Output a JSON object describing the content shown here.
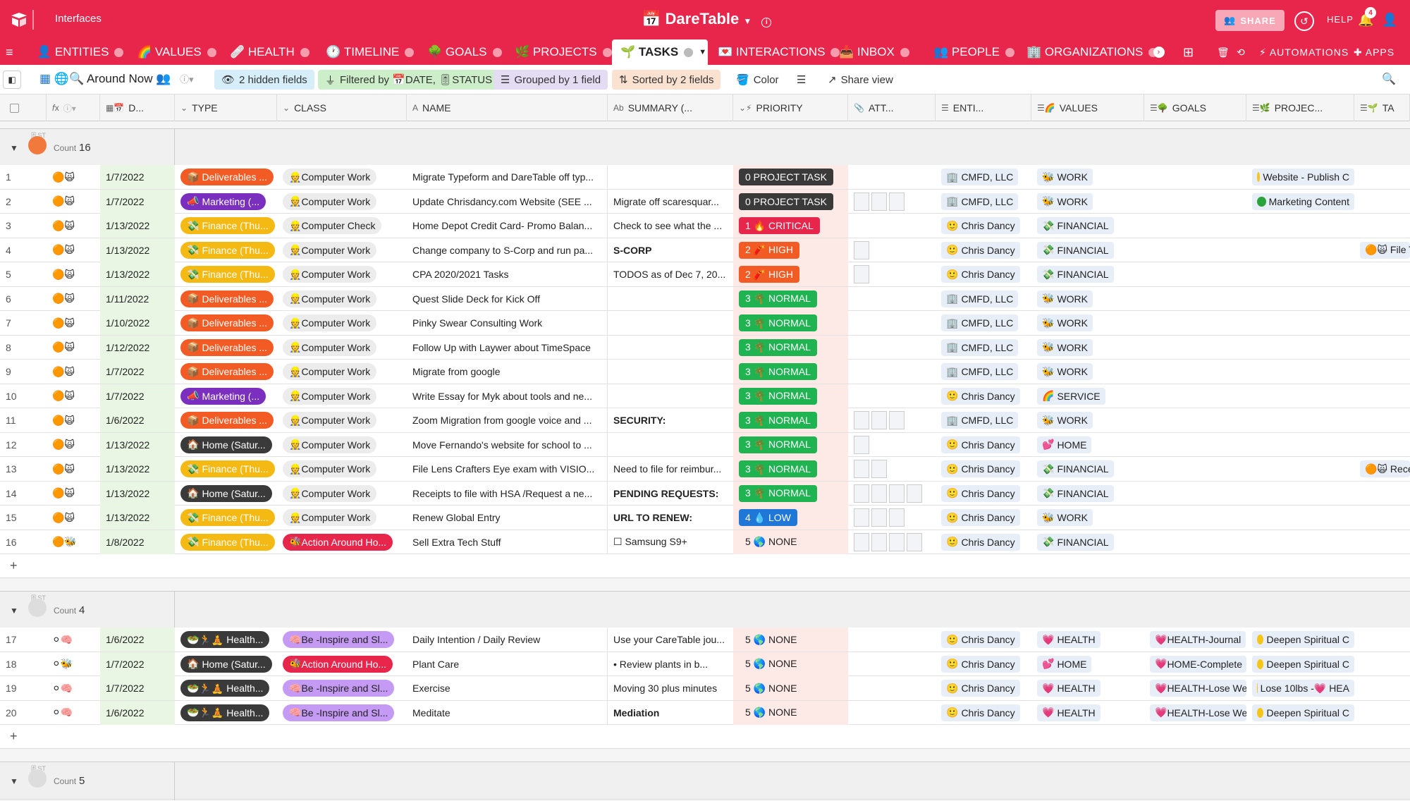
{
  "app": {
    "workspace_label": "Interfaces",
    "base_title": "DareTable",
    "share_label": "SHARE",
    "help_label": "HELP",
    "notification_count": "4"
  },
  "tabs": [
    {
      "label": "ENTITIES",
      "emoji": "👤"
    },
    {
      "label": "VALUES",
      "emoji": "🌈"
    },
    {
      "label": "HEALTH",
      "emoji": "🩹"
    },
    {
      "label": "TIMELINE",
      "emoji": "🕐"
    },
    {
      "label": "GOALS",
      "emoji": "🌳"
    },
    {
      "label": "PROJECTS",
      "emoji": "🌿"
    },
    {
      "label": "TASKS",
      "emoji": "🌱"
    },
    {
      "label": "INTERACTIONS",
      "emoji": "💌"
    },
    {
      "label": "INBOX",
      "emoji": "📥"
    },
    {
      "label": "PEOPLE",
      "emoji": "👥"
    },
    {
      "label": "ORGANIZATIONS",
      "emoji": "🏢"
    }
  ],
  "tab_actions": {
    "automations": "AUTOMATIONS",
    "apps": "APPS"
  },
  "view": {
    "name": "Around Now",
    "hidden_fields": "2 hidden fields",
    "filter_prefix": "Filtered by",
    "filter_date": "DATE,",
    "filter_status": "STATUS",
    "grouped": "Grouped by 1 field",
    "sorted": "Sorted by 2 fields",
    "color": "Color",
    "share_view": "Share view"
  },
  "columns": {
    "date": "D...",
    "type": "TYPE",
    "class": "CLASS",
    "name": "NAME",
    "summary": "SUMMARY (...",
    "priority": "PRIORITY",
    "attachments": "ATT...",
    "entities": "ENTI...",
    "values": "VALUES",
    "goals": "GOALS",
    "projects": "PROJEC...",
    "last": "TA"
  },
  "groups": [
    {
      "count_label": "Count",
      "count": "16",
      "icon_color": "#f2793c",
      "rows": [
        {
          "n": "1",
          "status": "🟠🙀",
          "date": "1/7/2022",
          "type": "Deliverables ...",
          "type_bg": "#f25c24",
          "type_emoji": "📦",
          "class": "Computer Work",
          "class_kind": "grey",
          "name": "Migrate Typeform and DareTable off typ...",
          "summary": "",
          "summary_bold": false,
          "priority": "0 PROJECT TASK",
          "prio_bg": "#3a3a3a",
          "att": 0,
          "entity": "CMFD, LLC",
          "entity_emoji": "🏢",
          "value": "WORK",
          "value_emoji": "🐝",
          "goal": "",
          "project": "Website - Publish C",
          "project_dot": "#f5c518",
          "last": ""
        },
        {
          "n": "2",
          "status": "🟠🙀",
          "date": "1/7/2022",
          "type": "Marketing (...",
          "type_bg": "#7b2fbf",
          "type_emoji": "📣",
          "class": "Computer Work",
          "class_kind": "grey",
          "name": "Update Chrisdancy.com Website (SEE ...",
          "summary": "Migrate off scaresquar...",
          "summary_bold": false,
          "priority": "0 PROJECT TASK",
          "prio_bg": "#3a3a3a",
          "att": 3,
          "entity": "CMFD, LLC",
          "entity_emoji": "🏢",
          "value": "WORK",
          "value_emoji": "🐝",
          "goal": "",
          "project": "Marketing Content",
          "project_dot": "#2aa43a",
          "last": ""
        },
        {
          "n": "3",
          "status": "🟠🙀",
          "date": "1/13/2022",
          "type": "Finance (Thu...",
          "type_bg": "#f5b914",
          "type_emoji": "💸",
          "class": "Computer Check",
          "class_kind": "grey",
          "name": "Home Depot Credit Card- Promo Balan...",
          "summary": "Check to see what the ...",
          "summary_bold": false,
          "priority": "1 🔥 CRITICAL",
          "prio_bg": "#e8254a",
          "att": 0,
          "entity": "Chris Dancy",
          "entity_emoji": "🙂",
          "value": "FINANCIAL",
          "value_emoji": "💸",
          "goal": "",
          "project": "",
          "project_dot": "",
          "last": ""
        },
        {
          "n": "4",
          "status": "🟠🙀",
          "date": "1/13/2022",
          "type": "Finance (Thu...",
          "type_bg": "#f5b914",
          "type_emoji": "💸",
          "class": "Computer Work",
          "class_kind": "grey",
          "name": "Change company to S-Corp and run pa...",
          "summary": "S-CORP",
          "summary_bold": true,
          "priority": "2 🧨 HIGH",
          "prio_bg": "#f25c24",
          "att": 1,
          "entity": "Chris Dancy",
          "entity_emoji": "🙂",
          "value": "FINANCIAL",
          "value_emoji": "💸",
          "goal": "",
          "project": "",
          "project_dot": "",
          "last": "🟠🙀 File T"
        },
        {
          "n": "5",
          "status": "🟠🙀",
          "date": "1/13/2022",
          "type": "Finance (Thu...",
          "type_bg": "#f5b914",
          "type_emoji": "💸",
          "class": "Computer Work",
          "class_kind": "grey",
          "name": "CPA 2020/2021 Tasks",
          "summary": "TODOS as of Dec 7, 20...",
          "summary_bold": false,
          "priority": "2 🧨 HIGH",
          "prio_bg": "#f25c24",
          "att": 1,
          "entity": "Chris Dancy",
          "entity_emoji": "🙂",
          "value": "FINANCIAL",
          "value_emoji": "💸",
          "goal": "",
          "project": "",
          "project_dot": "",
          "last": ""
        },
        {
          "n": "6",
          "status": "🟠🙀",
          "date": "1/11/2022",
          "type": "Deliverables ...",
          "type_bg": "#f25c24",
          "type_emoji": "📦",
          "class": "Computer Work",
          "class_kind": "grey",
          "name": "Quest Slide Deck for Kick Off",
          "summary": "",
          "summary_bold": false,
          "priority": "3 🌴 NORMAL",
          "prio_bg": "#20b352",
          "att": 0,
          "entity": "CMFD, LLC",
          "entity_emoji": "🏢",
          "value": "WORK",
          "value_emoji": "🐝",
          "goal": "",
          "project": "",
          "project_dot": "",
          "last": ""
        },
        {
          "n": "7",
          "status": "🟠🙀",
          "date": "1/10/2022",
          "type": "Deliverables ...",
          "type_bg": "#f25c24",
          "type_emoji": "📦",
          "class": "Computer Work",
          "class_kind": "grey",
          "name": "Pinky Swear Consulting Work",
          "summary": "",
          "summary_bold": false,
          "priority": "3 🌴 NORMAL",
          "prio_bg": "#20b352",
          "att": 0,
          "entity": "CMFD, LLC",
          "entity_emoji": "🏢",
          "value": "WORK",
          "value_emoji": "🐝",
          "goal": "",
          "project": "",
          "project_dot": "",
          "last": ""
        },
        {
          "n": "8",
          "status": "🟠🙀",
          "date": "1/12/2022",
          "type": "Deliverables ...",
          "type_bg": "#f25c24",
          "type_emoji": "📦",
          "class": "Computer Work",
          "class_kind": "grey",
          "name": "Follow Up with Laywer about TimeSpace",
          "summary": "",
          "summary_bold": false,
          "priority": "3 🌴 NORMAL",
          "prio_bg": "#20b352",
          "att": 0,
          "entity": "CMFD, LLC",
          "entity_emoji": "🏢",
          "value": "WORK",
          "value_emoji": "🐝",
          "goal": "",
          "project": "",
          "project_dot": "",
          "last": ""
        },
        {
          "n": "9",
          "status": "🟠🙀",
          "date": "1/7/2022",
          "type": "Deliverables ...",
          "type_bg": "#f25c24",
          "type_emoji": "📦",
          "class": "Computer Work",
          "class_kind": "grey",
          "name": "Migrate from google",
          "summary": "",
          "summary_bold": false,
          "priority": "3 🌴 NORMAL",
          "prio_bg": "#20b352",
          "att": 0,
          "entity": "CMFD, LLC",
          "entity_emoji": "🏢",
          "value": "WORK",
          "value_emoji": "🐝",
          "goal": "",
          "project": "",
          "project_dot": "",
          "last": ""
        },
        {
          "n": "10",
          "status": "🟠🙀",
          "date": "1/7/2022",
          "type": "Marketing (...",
          "type_bg": "#7b2fbf",
          "type_emoji": "📣",
          "class": "Computer Work",
          "class_kind": "grey",
          "name": "Write Essay for Myk about tools and ne...",
          "summary": "",
          "summary_bold": false,
          "priority": "3 🌴 NORMAL",
          "prio_bg": "#20b352",
          "att": 0,
          "entity": "Chris Dancy",
          "entity_emoji": "🙂",
          "value": "SERVICE",
          "value_emoji": "🌈",
          "goal": "",
          "project": "",
          "project_dot": "",
          "last": ""
        },
        {
          "n": "11",
          "status": "🟠🙀",
          "date": "1/6/2022",
          "type": "Deliverables ...",
          "type_bg": "#f25c24",
          "type_emoji": "📦",
          "class": "Computer Work",
          "class_kind": "grey",
          "name": "Zoom Migration from google voice and ...",
          "summary": "SECURITY:",
          "summary_bold": true,
          "priority": "3 🌴 NORMAL",
          "prio_bg": "#20b352",
          "att": 3,
          "entity": "CMFD, LLC",
          "entity_emoji": "🏢",
          "value": "WORK",
          "value_emoji": "🐝",
          "goal": "",
          "project": "",
          "project_dot": "",
          "last": ""
        },
        {
          "n": "12",
          "status": "🟠🙀",
          "date": "1/13/2022",
          "type": "Home (Satur...",
          "type_bg": "#3a3a3a",
          "type_emoji": "🏠",
          "class": "Computer Work",
          "class_kind": "grey",
          "name": "Move Fernando's website for school to ...",
          "summary": "",
          "summary_bold": false,
          "priority": "3 🌴 NORMAL",
          "prio_bg": "#20b352",
          "att": 1,
          "entity": "Chris Dancy",
          "entity_emoji": "🙂",
          "value": "HOME",
          "value_emoji": "💕",
          "goal": "",
          "project": "",
          "project_dot": "",
          "last": ""
        },
        {
          "n": "13",
          "status": "🟠🙀",
          "date": "1/13/2022",
          "type": "Finance (Thu...",
          "type_bg": "#f5b914",
          "type_emoji": "💸",
          "class": "Computer Work",
          "class_kind": "grey",
          "name": "File Lens Crafters Eye exam with VISIO...",
          "summary": "Need to file for reimbur...",
          "summary_bold": false,
          "priority": "3 🌴 NORMAL",
          "prio_bg": "#20b352",
          "att": 2,
          "entity": "Chris Dancy",
          "entity_emoji": "🙂",
          "value": "FINANCIAL",
          "value_emoji": "💸",
          "goal": "",
          "project": "",
          "project_dot": "",
          "last": "🟠🙀 Rece"
        },
        {
          "n": "14",
          "status": "🟠🙀",
          "date": "1/13/2022",
          "type": "Home (Satur...",
          "type_bg": "#3a3a3a",
          "type_emoji": "🏠",
          "class": "Computer Work",
          "class_kind": "grey",
          "name": "Receipts to file with HSA /Request a ne...",
          "summary": "PENDING REQUESTS:",
          "summary_bold": true,
          "priority": "3 🌴 NORMAL",
          "prio_bg": "#20b352",
          "att": 4,
          "entity": "Chris Dancy",
          "entity_emoji": "🙂",
          "value": "FINANCIAL",
          "value_emoji": "💸",
          "goal": "",
          "project": "",
          "project_dot": "",
          "last": ""
        },
        {
          "n": "15",
          "status": "🟠🙀",
          "date": "1/13/2022",
          "type": "Finance (Thu...",
          "type_bg": "#f5b914",
          "type_emoji": "💸",
          "class": "Computer Work",
          "class_kind": "grey",
          "name": "Renew Global Entry",
          "summary": "URL TO RENEW:",
          "summary_bold": true,
          "priority": "4 💧 LOW",
          "prio_bg": "#1f78d8",
          "att": 3,
          "entity": "Chris Dancy",
          "entity_emoji": "🙂",
          "value": "WORK",
          "value_emoji": "🐝",
          "goal": "",
          "project": "",
          "project_dot": "",
          "last": ""
        },
        {
          "n": "16",
          "status": "🟠🐝",
          "date": "1/8/2022",
          "type": "Finance (Thu...",
          "type_bg": "#f5b914",
          "type_emoji": "💸",
          "class": "Action Around Ho...",
          "class_kind": "red",
          "name": "Sell Extra Tech Stuff",
          "summary": "☐ Samsung S9+",
          "summary_bold": false,
          "priority": "5 🌎 NONE",
          "prio_bg": "",
          "att": 4,
          "entity": "Chris Dancy",
          "entity_emoji": "🙂",
          "value": "FINANCIAL",
          "value_emoji": "💸",
          "goal": "",
          "project": "",
          "project_dot": "",
          "last": ""
        }
      ]
    },
    {
      "count_label": "Count",
      "count": "4",
      "icon_color": "#dddddd",
      "rows": [
        {
          "n": "17",
          "status": "⚪🧠",
          "date": "1/6/2022",
          "type": "Health...",
          "type_bg": "#3a3a3a",
          "type_emoji": "🥗🏃🧘",
          "class": "Be -Inspire and Sl...",
          "class_kind": "purple",
          "name": "Daily Intention / Daily Review",
          "summary": "Use your CareTable jou...",
          "summary_bold": false,
          "priority": "5 🌎 NONE",
          "prio_bg": "",
          "att": 0,
          "entity": "Chris Dancy",
          "entity_emoji": "🙂",
          "value": "HEALTH",
          "value_emoji": "💗",
          "goal": "HEALTH-Journal",
          "project": "Deepen Spiritual C",
          "project_dot": "#f5c518",
          "last": ""
        },
        {
          "n": "18",
          "status": "⚪🐝",
          "date": "1/7/2022",
          "type": "Home (Satur...",
          "type_bg": "#3a3a3a",
          "type_emoji": "🏠",
          "class": "Action Around Ho...",
          "class_kind": "red",
          "name": "Plant Care",
          "summary": "• Review plants in b...",
          "summary_bold": false,
          "priority": "5 🌎 NONE",
          "prio_bg": "",
          "att": 0,
          "entity": "Chris Dancy",
          "entity_emoji": "🙂",
          "value": "HOME",
          "value_emoji": "💕",
          "goal": "HOME-Complete",
          "project": "Deepen Spiritual C",
          "project_dot": "#f5c518",
          "last": ""
        },
        {
          "n": "19",
          "status": "⚪🧠",
          "date": "1/7/2022",
          "type": "Health...",
          "type_bg": "#3a3a3a",
          "type_emoji": "🥗🏃🧘",
          "class": "Be -Inspire and Sl...",
          "class_kind": "purple",
          "name": "Exercise",
          "summary": "Moving 30 plus minutes",
          "summary_bold": false,
          "priority": "5 🌎 NONE",
          "prio_bg": "",
          "att": 0,
          "entity": "Chris Dancy",
          "entity_emoji": "🙂",
          "value": "HEALTH",
          "value_emoji": "💗",
          "goal": "HEALTH-Lose We",
          "project": "Lose 10lbs -💗 HEA",
          "project_dot": "#f5c518",
          "last": ""
        },
        {
          "n": "20",
          "status": "⚪🧠",
          "date": "1/6/2022",
          "type": "Health...",
          "type_bg": "#3a3a3a",
          "type_emoji": "🥗🏃🧘",
          "class": "Be -Inspire and Sl...",
          "class_kind": "purple",
          "name": "Meditate",
          "summary": "Mediation",
          "summary_bold": true,
          "priority": "5 🌎 NONE",
          "prio_bg": "",
          "att": 0,
          "entity": "Chris Dancy",
          "entity_emoji": "🙂",
          "value": "HEALTH",
          "value_emoji": "💗",
          "goal": "HEALTH-Lose We",
          "project": "Deepen Spiritual C",
          "project_dot": "#f5c518",
          "last": ""
        }
      ]
    },
    {
      "count_label": "Count",
      "count": "5",
      "icon_color": "#dddddd",
      "rows": []
    }
  ]
}
